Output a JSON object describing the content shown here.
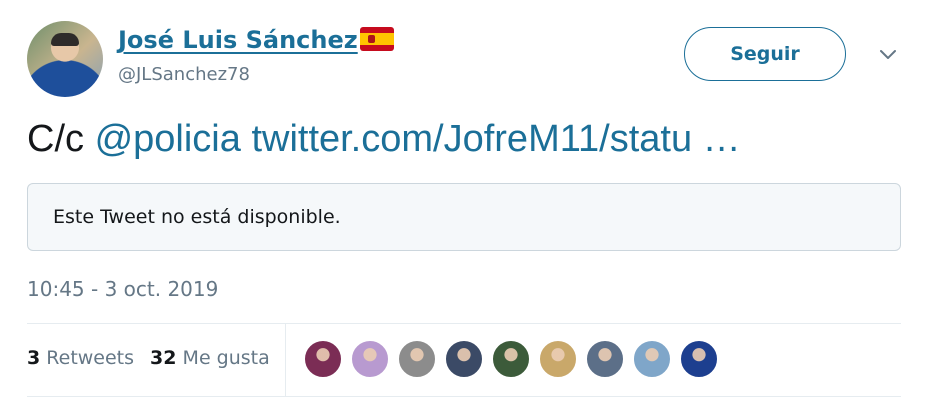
{
  "author": {
    "name": "José Luis Sánchez",
    "handle": "@JLSanchez78",
    "flag_icon": "spain-flag-icon",
    "avatar_icon": "avatar"
  },
  "actions": {
    "follow_label": "Seguir",
    "menu_icon": "chevron-down-icon"
  },
  "tweet": {
    "prefix": "C/c",
    "mention": "@policia",
    "link": "twitter.com/JofreM11/statu …",
    "quoted_notice": "Este Tweet no está disponible.",
    "timestamp": "10:45 - 3 oct. 2019"
  },
  "stats": {
    "retweets_count": "3",
    "retweets_label": "Retweets",
    "likes_count": "32",
    "likes_label": "Me gusta"
  },
  "colors": {
    "link": "#1b6f98",
    "secondary_text": "#657786",
    "border": "#ccd6dd"
  },
  "likers": [
    {
      "name": "liker-avatar-1",
      "bg": "#7b2d55"
    },
    {
      "name": "liker-avatar-2",
      "bg": "#b89ad0"
    },
    {
      "name": "liker-avatar-3",
      "bg": "#8c8c8c"
    },
    {
      "name": "liker-avatar-4",
      "bg": "#3b4a66"
    },
    {
      "name": "liker-avatar-5",
      "bg": "#3c5b3a"
    },
    {
      "name": "liker-avatar-6",
      "bg": "#c9a86a"
    },
    {
      "name": "liker-avatar-7",
      "bg": "#5c6f88"
    },
    {
      "name": "liker-avatar-8",
      "bg": "#7fa6c9"
    },
    {
      "name": "liker-avatar-9",
      "bg": "#1d3f8f"
    }
  ]
}
